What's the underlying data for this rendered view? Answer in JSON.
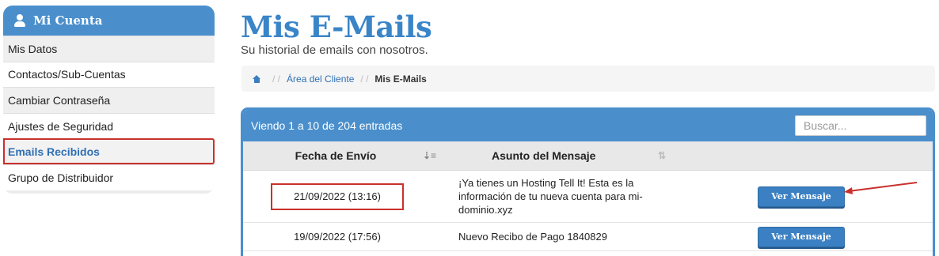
{
  "sidebar": {
    "title": "Mi Cuenta",
    "items": [
      {
        "label": "Mis Datos"
      },
      {
        "label": "Contactos/Sub-Cuentas"
      },
      {
        "label": "Cambiar Contraseña"
      },
      {
        "label": "Ajustes de Seguridad"
      },
      {
        "label": "Emails Recibidos"
      },
      {
        "label": "Grupo de Distribuidor"
      }
    ]
  },
  "header": {
    "title": "Mis E-Mails",
    "subtitle": "Su historial de emails con nosotros."
  },
  "breadcrumb": {
    "items": [
      "Área del Cliente",
      "Mis E-Mails"
    ]
  },
  "table": {
    "info": "Viendo 1 a 10 de 204 entradas",
    "search_placeholder": "Buscar...",
    "columns": [
      "Fecha de Envío",
      "Asunto del Mensaje"
    ],
    "rows": [
      {
        "date": "21/09/2022 (13:16)",
        "subject": "¡Ya tienes un Hosting Tell It! Esta es la información de tu nueva cuenta para mi-dominio.xyz",
        "action": "Ver Mensaje"
      },
      {
        "date": "19/09/2022 (17:56)",
        "subject": "Nuevo Recibo de Pago 1840829",
        "action": "Ver Mensaje"
      }
    ]
  },
  "colors": {
    "accent": "#4a8fcc",
    "highlight": "#c9302c"
  }
}
